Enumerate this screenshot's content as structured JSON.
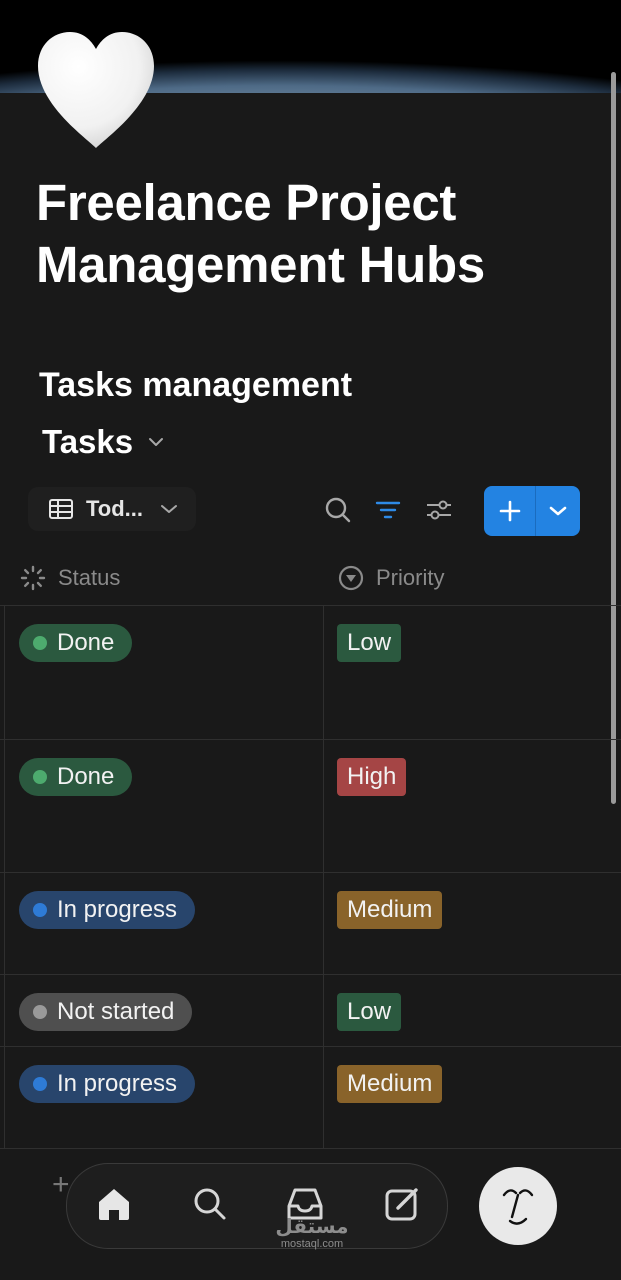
{
  "page": {
    "title": "Freelance Project Management Hubs",
    "cover_image": "earth-horizon-from-space",
    "page_icon": "white-heart-icon"
  },
  "section": {
    "title": "Tasks management"
  },
  "database": {
    "title": "Tasks",
    "view_label": "Tod...",
    "toolbar_icons": [
      "table-icon",
      "chevron-down-icon",
      "search-icon",
      "filter-icon",
      "settings-sliders-icon",
      "plus-icon",
      "chevron-down-icon"
    ]
  },
  "columns": {
    "status": "Status",
    "priority": "Priority"
  },
  "rows": [
    {
      "status": "Done",
      "status_color": "#2b593f",
      "status_dot": "#4dab6e",
      "priority": "Low",
      "priority_color": "#2b593f"
    },
    {
      "status": "Done",
      "status_color": "#2b593f",
      "status_dot": "#4dab6e",
      "priority": "High",
      "priority_color": "#a54545"
    },
    {
      "status": "In progress",
      "status_color": "#28456c",
      "status_dot": "#2e7bd6",
      "priority": "Medium",
      "priority_color": "#89632a"
    },
    {
      "status": "Not started",
      "status_color": "#4f4f4f",
      "status_dot": "#9a9a9a",
      "priority": "Low",
      "priority_color": "#2b593f"
    },
    {
      "status": "In progress",
      "status_color": "#28456c",
      "status_dot": "#2e7bd6",
      "priority": "Medium",
      "priority_color": "#89632a"
    }
  ],
  "bottom_nav": {
    "items": [
      "home-icon",
      "search-icon",
      "inbox-icon",
      "compose-icon"
    ],
    "avatar": "user-avatar-sketch"
  },
  "watermark": {
    "arabic": "مستقل",
    "latin": "mostaql.com"
  },
  "colors": {
    "background": "#191919",
    "accent_blue": "#2383e2"
  }
}
